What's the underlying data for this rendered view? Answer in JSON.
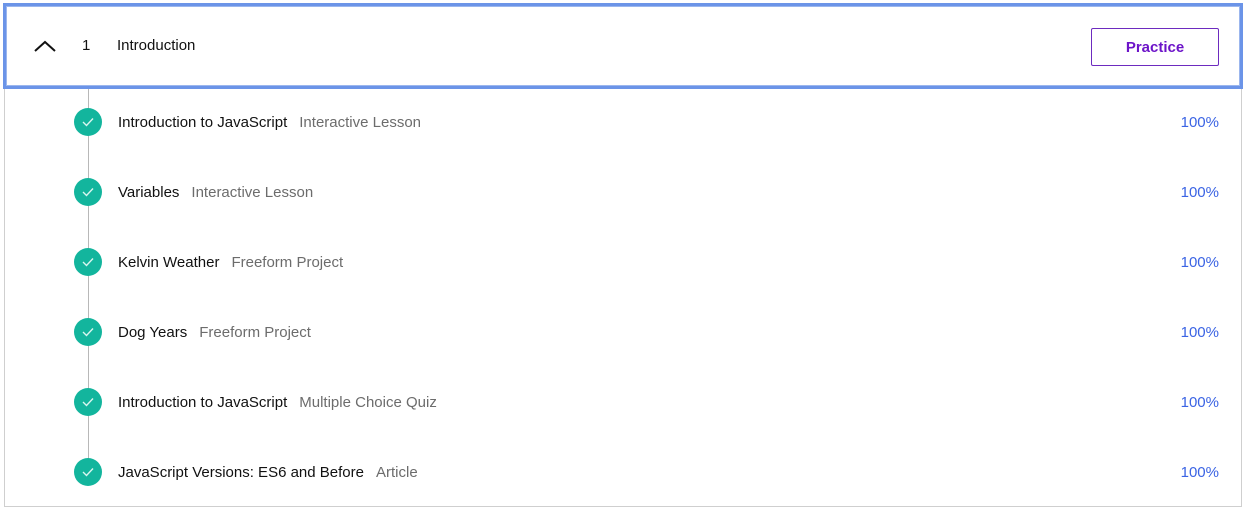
{
  "module": {
    "number": "1",
    "title": "Introduction",
    "practice_label": "Practice"
  },
  "lessons": [
    {
      "title": "Introduction to JavaScript",
      "type": "Interactive Lesson",
      "progress": "100%"
    },
    {
      "title": "Variables",
      "type": "Interactive Lesson",
      "progress": "100%"
    },
    {
      "title": "Kelvin Weather",
      "type": "Freeform Project",
      "progress": "100%"
    },
    {
      "title": "Dog Years",
      "type": "Freeform Project",
      "progress": "100%"
    },
    {
      "title": "Introduction to JavaScript",
      "type": "Multiple Choice Quiz",
      "progress": "100%"
    },
    {
      "title": "JavaScript Versions: ES6 and Before",
      "type": "Article",
      "progress": "100%"
    }
  ],
  "colors": {
    "check": "#13b59d",
    "progress": "#3a63e4",
    "practice": "#6d14c9",
    "focus_outline": "#6b94e8"
  },
  "icons": {
    "collapse": "chevron-up-icon",
    "completed": "checkmark-icon"
  }
}
